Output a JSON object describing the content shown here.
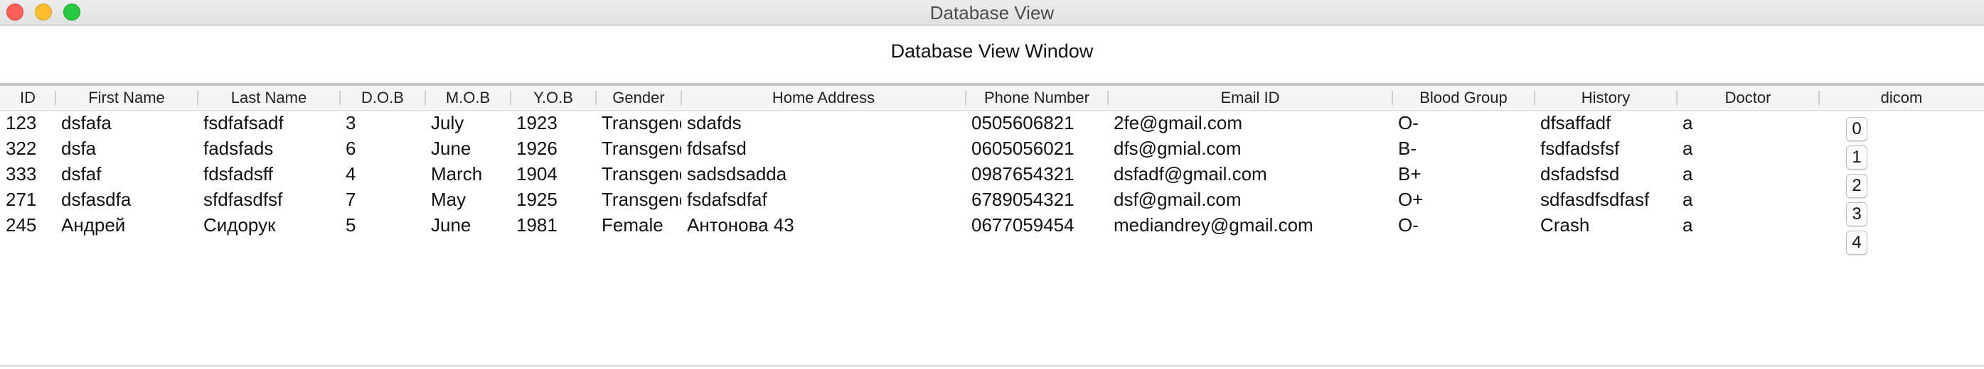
{
  "window": {
    "title": "Database View"
  },
  "header": {
    "title": "Database View Window"
  },
  "table": {
    "columns": [
      "ID",
      "First Name",
      "Last Name",
      "D.O.B",
      "M.O.B",
      "Y.O.B",
      "Gender",
      "Home Address",
      "Phone Number",
      "Email ID",
      "Blood Group",
      "History",
      "Doctor",
      "dicom"
    ],
    "rows": [
      [
        "123",
        "dsfafa",
        "fsdfafsadf",
        "3",
        "July",
        "1923",
        "Transgender",
        "sdafds",
        "0505606821",
        "2fe@gmail.com",
        "O-",
        "dfsaffadf",
        "a"
      ],
      [
        "322",
        "dsfa",
        "fadsfads",
        "6",
        "June",
        "1926",
        "Transgender",
        "fdsafsd",
        "0605056021",
        "dfs@gmial.com",
        "B-",
        "fsdfadsfsf",
        "a"
      ],
      [
        "333",
        "dsfaf",
        "fdsfadsff",
        "4",
        "March",
        "1904",
        "Transgender",
        "sadsdsadda",
        "0987654321",
        "dsfadf@gmail.com",
        "B+",
        "dsfadsfsd",
        "a"
      ],
      [
        "271",
        "dsfasdfa",
        "sfdfasdfsf",
        "7",
        "May",
        "1925",
        "Transgender",
        "fsdafsdfaf",
        "6789054321",
        "dsf@gmail.com",
        "O+",
        "sdfasdfsdfasf",
        "a"
      ],
      [
        "245",
        "Андрей",
        "Сидорук",
        "5",
        "June",
        "1981",
        "Female",
        "Антонова 43",
        "0677059454",
        "mediandrey@gmail.com",
        "O-",
        "Crash",
        "a"
      ]
    ],
    "dicom_buttons": [
      "0",
      "1",
      "2",
      "3",
      "4"
    ]
  }
}
